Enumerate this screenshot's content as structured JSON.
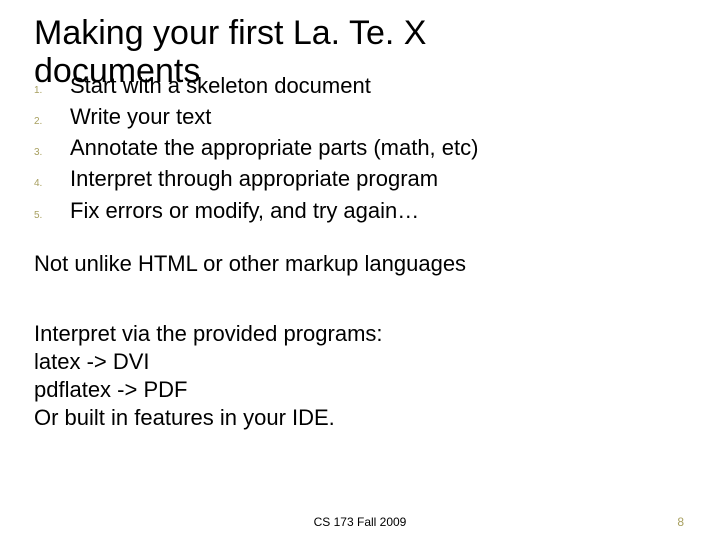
{
  "title_line1": "Making your first La. Te. X",
  "title_line2": "documents",
  "list": [
    {
      "n": "1.",
      "t": "Start with a skeleton document"
    },
    {
      "n": "2.",
      "t": "Write your text"
    },
    {
      "n": "3.",
      "t": "Annotate the appropriate parts (math, etc)"
    },
    {
      "n": "4.",
      "t": "Interpret through appropriate program"
    },
    {
      "n": "5.",
      "t": "Fix errors or modify, and try again…"
    }
  ],
  "para1": "Not unlike HTML or other markup languages",
  "para2_lines": [
    "Interpret via the provided programs:",
    "latex -> DVI",
    "pdflatex -> PDF",
    "Or built in features in your IDE."
  ],
  "footer_course": "CS 173 Fall 2009",
  "footer_page": "8"
}
